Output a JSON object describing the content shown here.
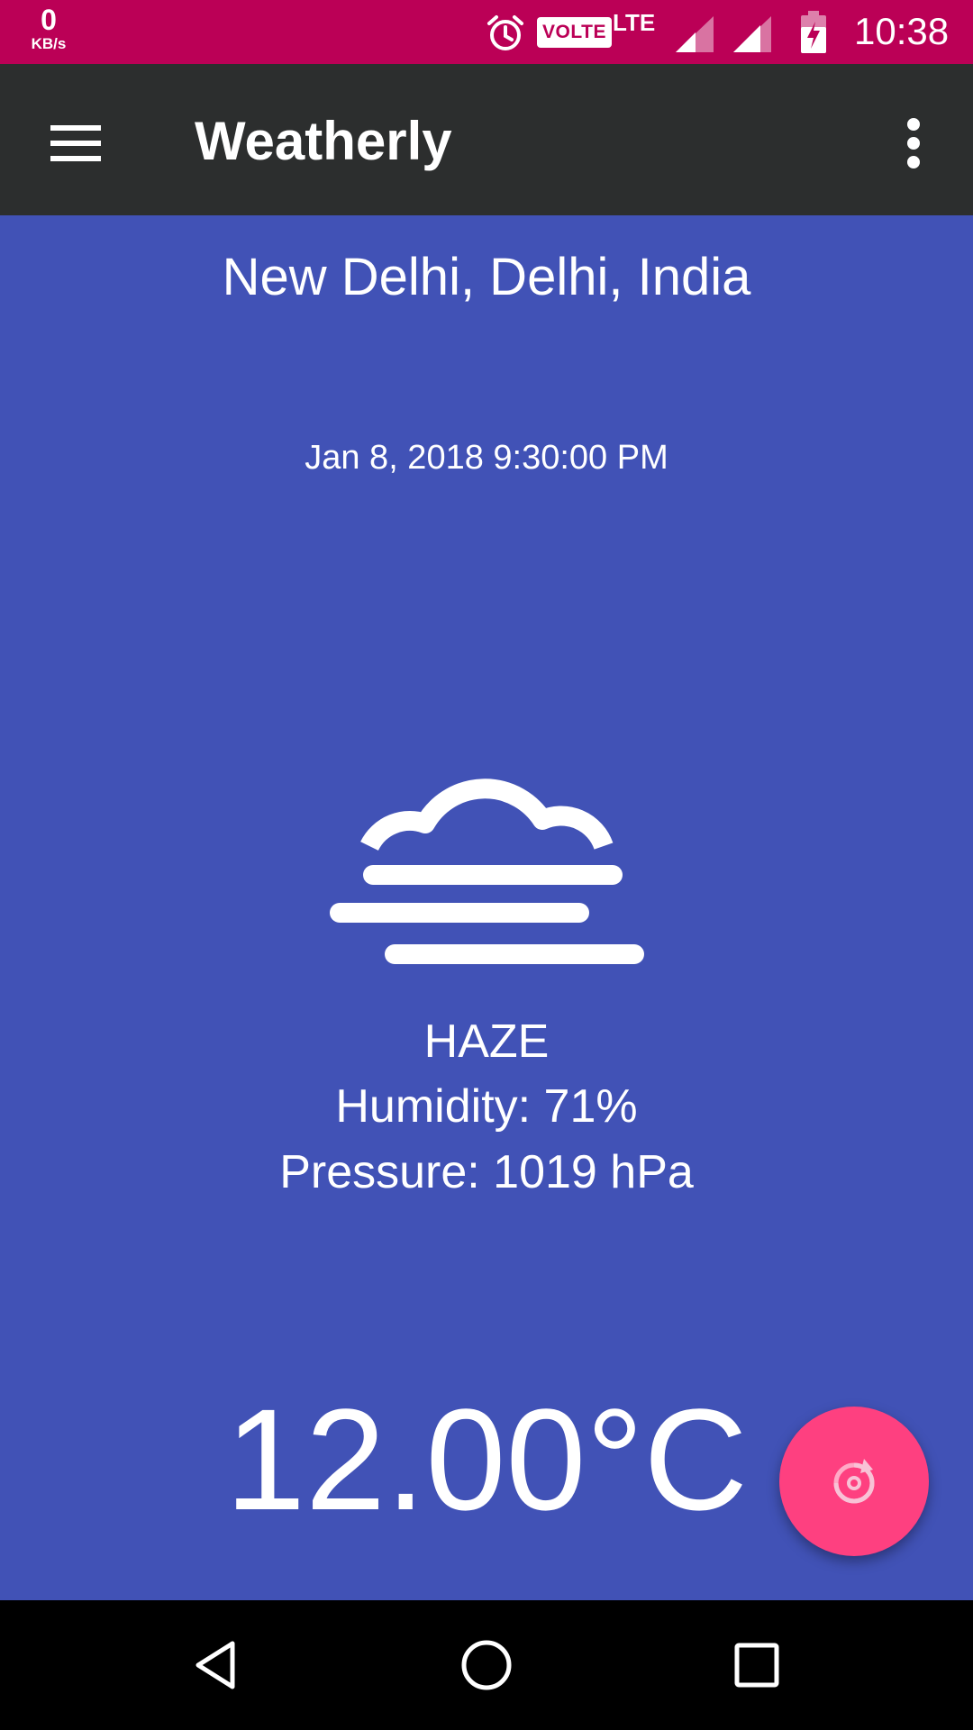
{
  "status_bar": {
    "net_speed_value": "0",
    "net_speed_unit": "KB/s",
    "network_type": "LTE",
    "volte_label": "VOLTE",
    "time": "10:38",
    "icons": [
      "alarm-icon",
      "volte-icon",
      "signal-icon",
      "signal-icon",
      "battery-charging-icon"
    ],
    "background_color": "#bb0056"
  },
  "app_bar": {
    "title": "Weatherly",
    "menu_icon": "hamburger-menu-icon",
    "overflow_icon": "more-vert-icon",
    "background_color": "#2c2e2e"
  },
  "weather": {
    "location": "New Delhi, Delhi, India",
    "datetime": "Jan 8, 2018 9:30:00 PM",
    "icon": "haze-icon",
    "condition": "HAZE",
    "humidity": "Humidity: 71%",
    "pressure": "Pressure: 1019 hPa",
    "temperature": "12.00°C",
    "background_color": "#4152b6"
  },
  "fab": {
    "icon": "refresh-icon",
    "color": "#fe4080"
  },
  "nav_bar": {
    "buttons": [
      "back-icon",
      "home-icon",
      "recents-icon"
    ]
  }
}
